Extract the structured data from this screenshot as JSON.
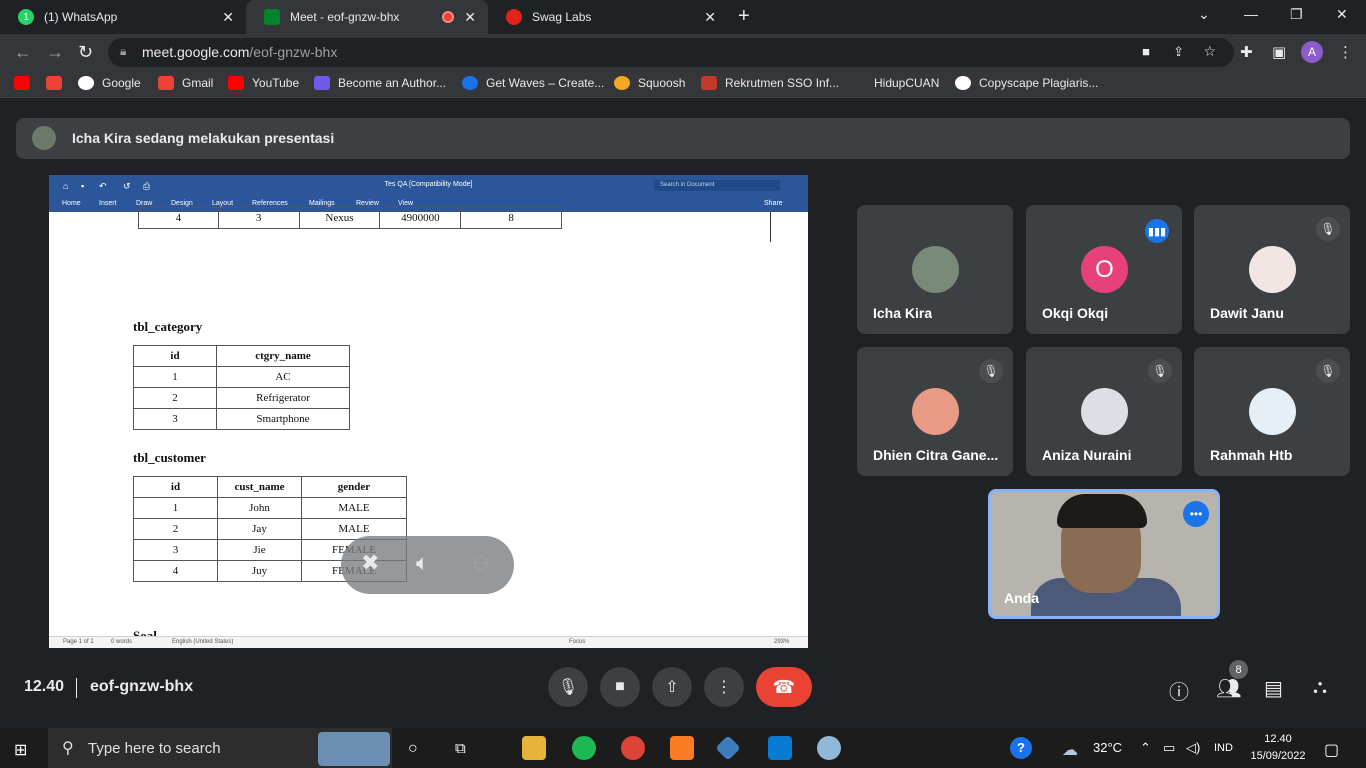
{
  "browser": {
    "tabs": [
      {
        "label": "(1) WhatsApp",
        "color": "#25d366"
      },
      {
        "label": "Meet - eof-gnzw-bhx",
        "color": "#00832d"
      },
      {
        "label": "Swag Labs",
        "color": "#e2231a"
      }
    ],
    "url_domain": "meet.google.com",
    "url_path": "/eof-gnzw-bhx",
    "profile_initial": "A",
    "bookmarks": [
      "Google",
      "Gmail",
      "YouTube",
      "Become an Author...",
      "Get Waves – Create...",
      "Squoosh",
      "Rekrutmen SSO Inf...",
      "HidupCUAN",
      "Copyscape Plagiaris..."
    ]
  },
  "meet": {
    "banner": "Icha Kira sedang melakukan presentasi",
    "word": {
      "title": "Tes QA [Compatibility Mode]",
      "search_placeholder": "Search in Document",
      "menu": [
        "Home",
        "Insert",
        "Draw",
        "Design",
        "Layout",
        "References",
        "Mailings",
        "Review",
        "View"
      ],
      "share": "Share",
      "top_row": [
        "4",
        "3",
        "Nexus",
        "4900000",
        "8"
      ],
      "category_heading": "tbl_category",
      "category_headers": [
        "id",
        "ctgry_name"
      ],
      "category_rows": [
        [
          "1",
          "AC"
        ],
        [
          "2",
          "Refrigerator"
        ],
        [
          "3",
          "Smartphone"
        ]
      ],
      "customer_heading": "tbl_customer",
      "customer_headers": [
        "id",
        "cust_name",
        "gender"
      ],
      "customer_rows": [
        [
          "1",
          "John",
          "MALE"
        ],
        [
          "2",
          "Jay",
          "MALE"
        ],
        [
          "3",
          "Jie",
          "FEMALE"
        ],
        [
          "4",
          "Juy",
          "FEMALE"
        ]
      ],
      "next_heading": "Soal",
      "status_page": "Page 1 of 1",
      "status_words": "0 words",
      "status_lang": "English (United States)",
      "status_focus": "Focus",
      "status_zoom": "293%"
    },
    "participants": [
      {
        "name": "Icha Kira",
        "avatar_color": "#7a8a78"
      },
      {
        "name": "Okqi Okqi",
        "avatar_color": "#e8407a",
        "initial": "O"
      },
      {
        "name": "Dawit Janu",
        "avatar_color": "#f2e6e4"
      },
      {
        "name": "Dhien Citra Gane...",
        "avatar_color": "#e89a84"
      },
      {
        "name": "Aniza Nuraini",
        "avatar_color": "#dcdfe4"
      },
      {
        "name": "Rahmah Htb",
        "avatar_color": "#e6eef6"
      }
    ],
    "self_name": "Anda",
    "time": "12.40",
    "meeting_code": "eof-gnzw-bhx",
    "people_count": "8"
  },
  "taskbar": {
    "search_placeholder": "Type here to search",
    "temperature": "32°C",
    "language": "IND",
    "time": "12.40",
    "date": "15/09/2022"
  }
}
